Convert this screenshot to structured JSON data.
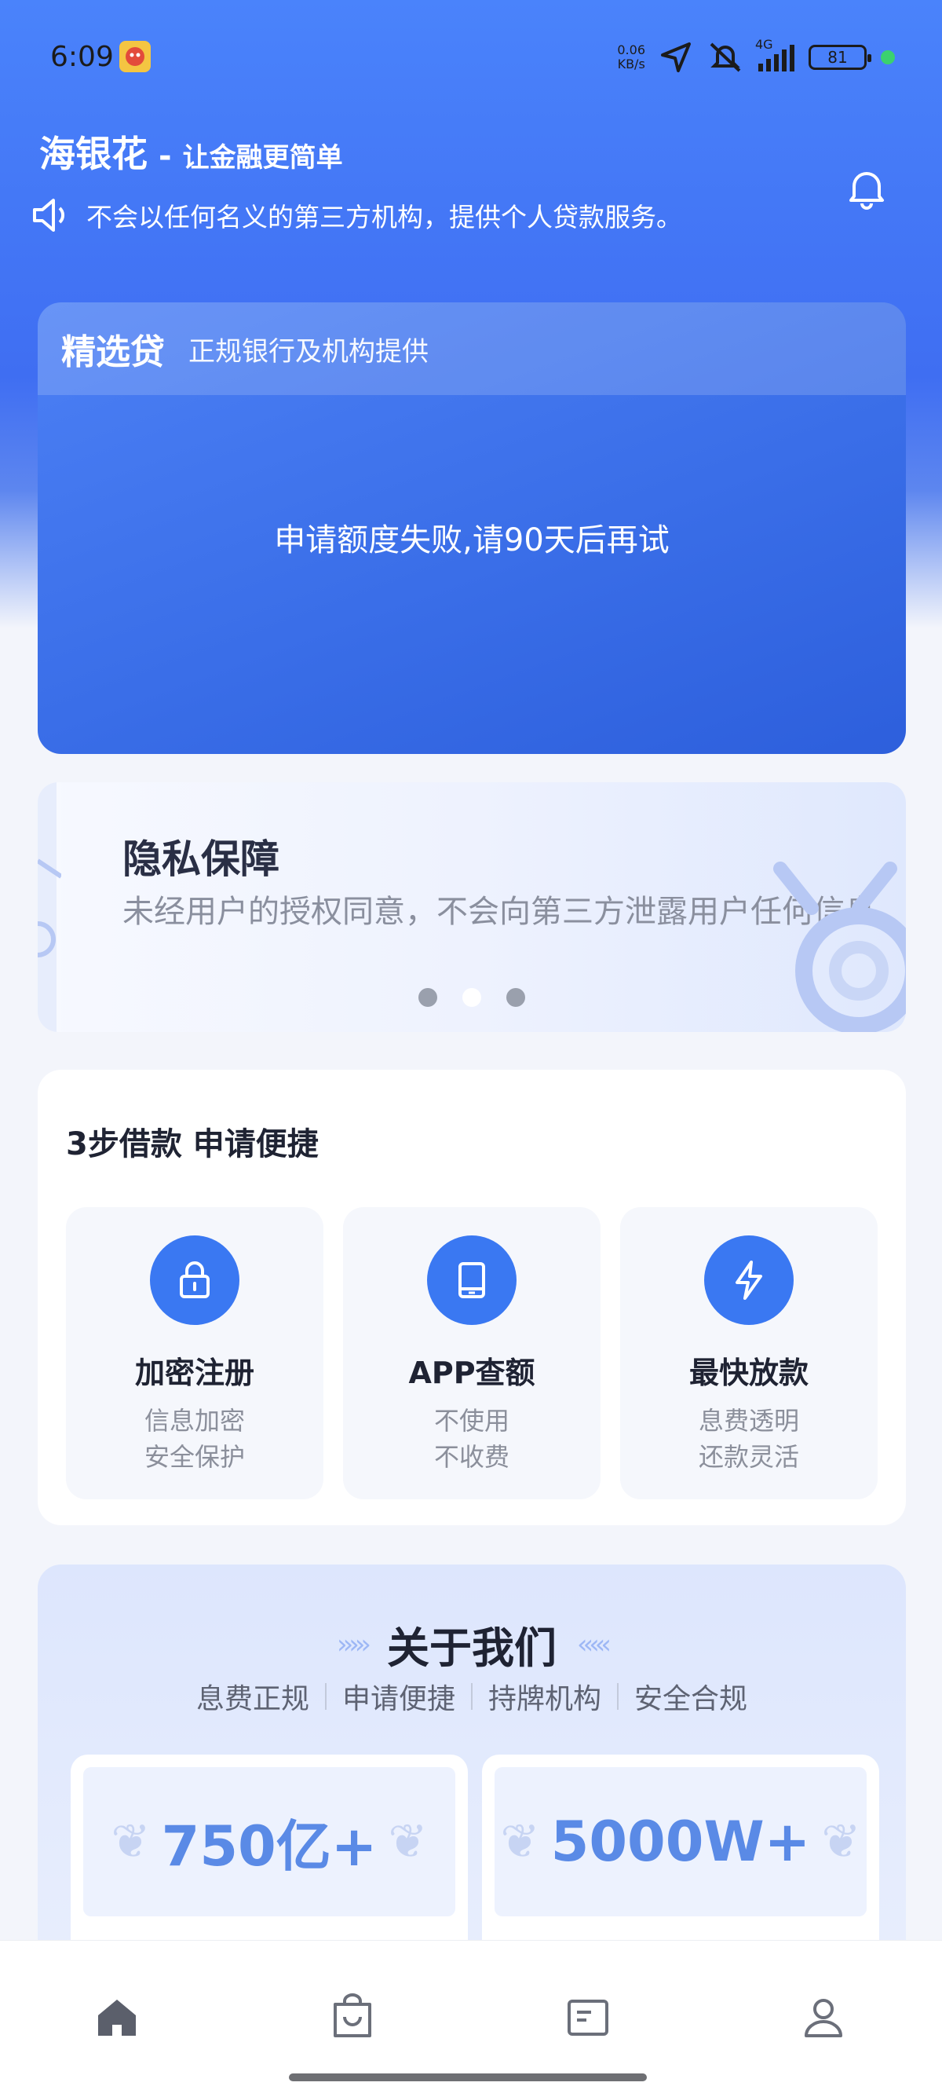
{
  "status_bar": {
    "time": "6:09",
    "net_speed_value": "0.06",
    "net_speed_unit": "KB/s",
    "network": "4G",
    "battery": "81"
  },
  "header": {
    "brand_name": "海银花",
    "separator": "-",
    "slogan": "让金融更简单",
    "notice": "不会以任何名义的第三方机构，提供个人贷款服务。"
  },
  "loan_card": {
    "title": "精选贷",
    "subtitle": "正规银行及机构提供",
    "message": "申请额度失败,请90天后再试"
  },
  "banner": {
    "title": "隐私保障",
    "text": "未经用户的授权同意，不会向第三方泄露用户任何信息",
    "active_index": 1,
    "slide_count": 3
  },
  "steps": {
    "title": "3步借款 申请便捷",
    "items": [
      {
        "icon": "lock-icon",
        "label": "加密注册",
        "line1": "信息加密",
        "line2": "安全保护"
      },
      {
        "icon": "tablet-icon",
        "label": "APP查额",
        "line1": "不使用",
        "line2": "不收费"
      },
      {
        "icon": "lightning-icon",
        "label": "最快放款",
        "line1": "息费透明",
        "line2": "还款灵活"
      }
    ]
  },
  "about": {
    "title": "关于我们",
    "tags": [
      "息费正规",
      "申请便捷",
      "持牌机构",
      "安全合规"
    ],
    "stats": [
      "750亿+",
      "5000W+"
    ]
  },
  "bottom_nav": {
    "items": [
      "home-icon",
      "bag-icon",
      "news-icon",
      "profile-icon"
    ],
    "active_index": 0
  },
  "colors": {
    "accent": "#3a78f2",
    "header_bg": "#4a83fb",
    "stat_text": "#5a8ae6"
  }
}
